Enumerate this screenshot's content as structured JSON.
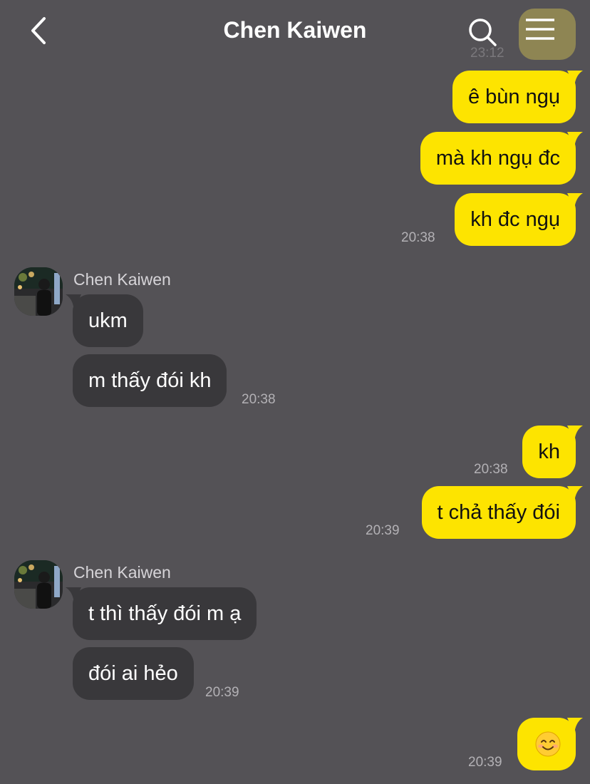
{
  "header": {
    "title": "Chen Kaiwen",
    "back_icon": "chevron-left-icon",
    "search_icon": "search-icon",
    "menu_icon": "hamburger-menu-icon"
  },
  "peek": {
    "time": "23:12"
  },
  "colors": {
    "background": "#545256",
    "my_bubble": "#fde400",
    "their_bubble": "#39383b",
    "timestamp": "#b3b1b5"
  },
  "messages": [
    {
      "from": "me",
      "text": "ê bùn ngụ"
    },
    {
      "from": "me",
      "text": "mà kh ngụ đc"
    },
    {
      "from": "me",
      "text": "kh đc ngụ",
      "time": "20:38"
    },
    {
      "from": "them",
      "sender": "Chen Kaiwen",
      "text": "ukm"
    },
    {
      "from": "them",
      "text": "m thấy đói kh",
      "time": "20:38"
    },
    {
      "from": "me",
      "text": "kh",
      "time": "20:38"
    },
    {
      "from": "me",
      "text": "t chả thấy đói",
      "time": "20:39"
    },
    {
      "from": "them",
      "sender": "Chen Kaiwen",
      "text": "t thì thấy đói m ạ"
    },
    {
      "from": "them",
      "text": "đói ai hẻo",
      "time": "20:39"
    },
    {
      "from": "me",
      "emoji": "smiling-face-icon",
      "time": "20:39"
    }
  ]
}
